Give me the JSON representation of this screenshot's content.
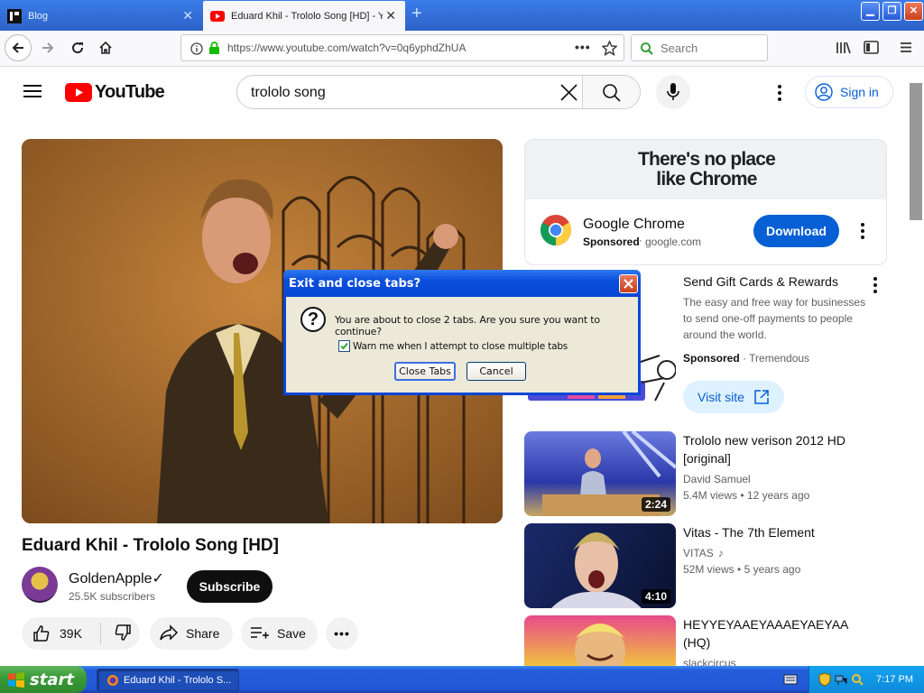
{
  "browser": {
    "tabs": [
      {
        "title": "Blog",
        "active": false
      },
      {
        "title": "Eduard Khil - Trololo Song [HD] - Y",
        "active": true
      }
    ],
    "url": "https://www.youtube.com/watch?v=0q6yphdZhUA",
    "search_placeholder": "Search",
    "icons": [
      "back-icon",
      "forward-icon",
      "reload-icon",
      "home-icon",
      "info-icon",
      "lock-icon",
      "page-actions-icon",
      "bookmark-star-icon",
      "library-icon",
      "sidebar-icon",
      "menu-icon"
    ]
  },
  "youtube": {
    "logo_text": "YouTube",
    "search_query": "trololo song",
    "sign_in": "Sign in",
    "video": {
      "title": "Eduard Khil - Trololo Song [HD]",
      "channel": "GoldenApple✓",
      "subscribers": "25.5K subscribers",
      "subscribe": "Subscribe",
      "likes": "39K",
      "share": "Share",
      "save": "Save"
    },
    "ad": {
      "banner_line1": "There's no place",
      "banner_line2": "like Chrome",
      "name": "Google Chrome",
      "sponsored": "Sponsored",
      "domain": "google.com",
      "download": "Download"
    },
    "ad2": {
      "title": "Send Gift Cards & Rewards",
      "desc": "The easy and free way for businesses to send one-off payments to people around the world.",
      "sponsored": "Sponsored",
      "advertiser": "Tremendous",
      "visit": "Visit site"
    },
    "recommendations": [
      {
        "title": "Trololo new verison 2012 HD [original]",
        "channel": "David Samuel",
        "views": "5.4M views",
        "age": "12 years ago",
        "duration": "2:24"
      },
      {
        "title": "Vitas - The 7th Element",
        "channel": "VITAS",
        "views": "52M views",
        "age": "5 years ago",
        "duration": "4:10"
      },
      {
        "title": "HEYYEYAAEYAAAEYAEYAA (HQ)",
        "channel": "slackcircus",
        "views": "",
        "age": "",
        "duration": ""
      }
    ]
  },
  "dialog": {
    "title": "Exit and close tabs?",
    "message": "You are about to close 2 tabs. Are you sure you want to continue?",
    "checkbox_label": "Warn me when I attempt to close multiple tabs",
    "checkbox_checked": true,
    "close_tabs": "Close Tabs",
    "cancel": "Cancel"
  },
  "taskbar": {
    "start": "start",
    "task_item": "Eduard Khil - Trololo S...",
    "clock": "7:17 PM"
  },
  "colors": {
    "youtube_red": "#ff0000",
    "link_blue": "#065fd4",
    "xp_blue": "#245edb",
    "xp_green": "#3a9a38"
  }
}
